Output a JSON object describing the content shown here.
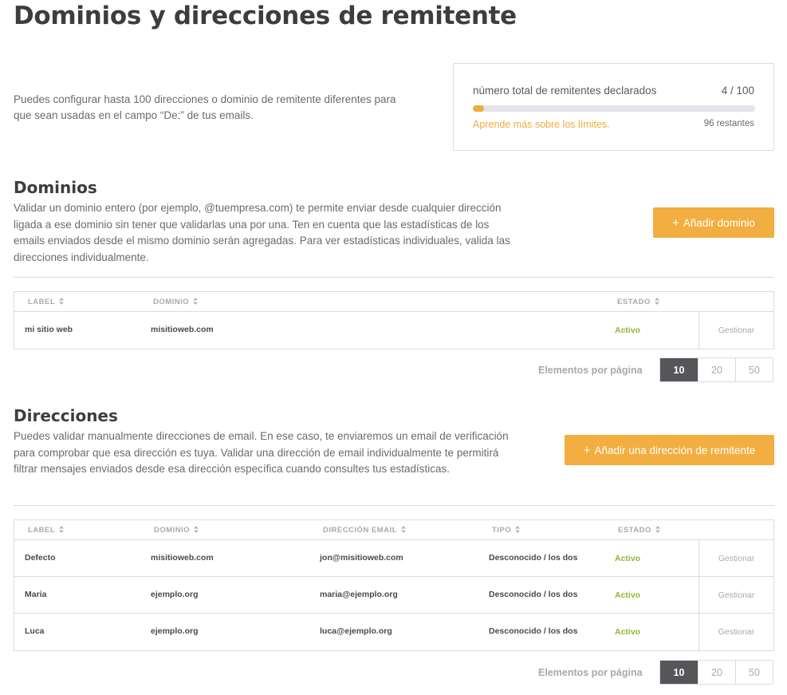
{
  "page": {
    "title": "Dominios y direcciones de remitente",
    "intro": "Puedes configurar hasta 100 direcciones o dominio de remitente diferentes para que sean usadas en el campo “De:” de tus emails."
  },
  "quota": {
    "label": "número total de remitentes declarados",
    "count": "4 / 100",
    "used": 4,
    "max": 100,
    "link": "Aprende más sobre los límites.",
    "remaining": "96 restantes"
  },
  "colors": {
    "accent": "#f2ae40",
    "status_active": "#8eb63a",
    "pager_active": "#55565a"
  },
  "domains": {
    "title": "Dominios",
    "description": "Validar un dominio entero (por ejemplo, @tuempresa.com) te permite enviar desde cualquier dirección ligada a ese dominio sin tener que validarlas una por una. Ten en cuenta que las estadísticas de los emails enviados desde el mismo dominio serán agregadas. Para ver estadísticas individuales, valida las direcciones individualmente.",
    "add_button": "Añadir dominio",
    "columns": [
      "LABEL",
      "DOMINIO",
      "ESTADO"
    ],
    "rows": [
      {
        "label": "mi sitio web",
        "domain": "misitioweb.com",
        "status": "Activo",
        "action": "Gestionar"
      }
    ],
    "pager": {
      "label": "Elementos por página",
      "options": [
        "10",
        "20",
        "50"
      ],
      "selected": "10"
    }
  },
  "addresses": {
    "title": "Direcciones",
    "description": "Puedes validar manualmente direcciones de email. En ese caso, te enviaremos un email de verificación para comprobar que esa dirección es tuya. Validar una dirección de email individualmente te permitirá filtrar mensajes enviados desde esa dirección específica cuando consultes tus estadísticas.",
    "add_button": "Añadir una dirección de remitente",
    "columns": [
      "LABEL",
      "DOMINIO",
      "DIRECCIÓN EMAIL",
      "TIPO",
      "ESTADO"
    ],
    "rows": [
      {
        "label": "Defecto",
        "domain": "misitioweb.com",
        "email": "jon@misitioweb.com",
        "type": "Desconocido / los dos",
        "status": "Activo",
        "action": "Gestionar"
      },
      {
        "label": "Maria",
        "domain": "ejemplo.org",
        "email": "maria@ejemplo.org",
        "type": "Desconocido / los dos",
        "status": "Activo",
        "action": "Gestionar"
      },
      {
        "label": "Luca",
        "domain": "ejemplo.org",
        "email": "luca@ejemplo.org",
        "type": "Desconocido / los dos",
        "status": "Activo",
        "action": "Gestionar"
      }
    ],
    "pager": {
      "label": "Elementos por página",
      "options": [
        "10",
        "20",
        "50"
      ],
      "selected": "10"
    }
  }
}
